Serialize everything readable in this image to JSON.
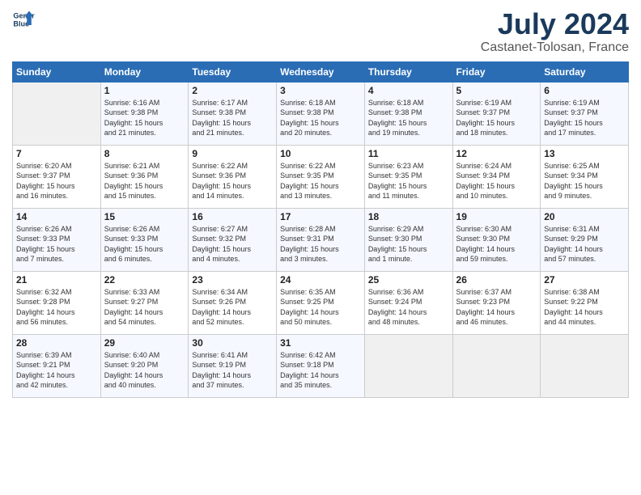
{
  "logo": {
    "line1": "General",
    "line2": "Blue"
  },
  "title": "July 2024",
  "location": "Castanet-Tolosan, France",
  "days_of_week": [
    "Sunday",
    "Monday",
    "Tuesday",
    "Wednesday",
    "Thursday",
    "Friday",
    "Saturday"
  ],
  "weeks": [
    [
      {
        "day": "",
        "info": ""
      },
      {
        "day": "1",
        "info": "Sunrise: 6:16 AM\nSunset: 9:38 PM\nDaylight: 15 hours\nand 21 minutes."
      },
      {
        "day": "2",
        "info": "Sunrise: 6:17 AM\nSunset: 9:38 PM\nDaylight: 15 hours\nand 21 minutes."
      },
      {
        "day": "3",
        "info": "Sunrise: 6:18 AM\nSunset: 9:38 PM\nDaylight: 15 hours\nand 20 minutes."
      },
      {
        "day": "4",
        "info": "Sunrise: 6:18 AM\nSunset: 9:38 PM\nDaylight: 15 hours\nand 19 minutes."
      },
      {
        "day": "5",
        "info": "Sunrise: 6:19 AM\nSunset: 9:37 PM\nDaylight: 15 hours\nand 18 minutes."
      },
      {
        "day": "6",
        "info": "Sunrise: 6:19 AM\nSunset: 9:37 PM\nDaylight: 15 hours\nand 17 minutes."
      }
    ],
    [
      {
        "day": "7",
        "info": "Sunrise: 6:20 AM\nSunset: 9:37 PM\nDaylight: 15 hours\nand 16 minutes."
      },
      {
        "day": "8",
        "info": "Sunrise: 6:21 AM\nSunset: 9:36 PM\nDaylight: 15 hours\nand 15 minutes."
      },
      {
        "day": "9",
        "info": "Sunrise: 6:22 AM\nSunset: 9:36 PM\nDaylight: 15 hours\nand 14 minutes."
      },
      {
        "day": "10",
        "info": "Sunrise: 6:22 AM\nSunset: 9:35 PM\nDaylight: 15 hours\nand 13 minutes."
      },
      {
        "day": "11",
        "info": "Sunrise: 6:23 AM\nSunset: 9:35 PM\nDaylight: 15 hours\nand 11 minutes."
      },
      {
        "day": "12",
        "info": "Sunrise: 6:24 AM\nSunset: 9:34 PM\nDaylight: 15 hours\nand 10 minutes."
      },
      {
        "day": "13",
        "info": "Sunrise: 6:25 AM\nSunset: 9:34 PM\nDaylight: 15 hours\nand 9 minutes."
      }
    ],
    [
      {
        "day": "14",
        "info": "Sunrise: 6:26 AM\nSunset: 9:33 PM\nDaylight: 15 hours\nand 7 minutes."
      },
      {
        "day": "15",
        "info": "Sunrise: 6:26 AM\nSunset: 9:33 PM\nDaylight: 15 hours\nand 6 minutes."
      },
      {
        "day": "16",
        "info": "Sunrise: 6:27 AM\nSunset: 9:32 PM\nDaylight: 15 hours\nand 4 minutes."
      },
      {
        "day": "17",
        "info": "Sunrise: 6:28 AM\nSunset: 9:31 PM\nDaylight: 15 hours\nand 3 minutes."
      },
      {
        "day": "18",
        "info": "Sunrise: 6:29 AM\nSunset: 9:30 PM\nDaylight: 15 hours\nand 1 minute."
      },
      {
        "day": "19",
        "info": "Sunrise: 6:30 AM\nSunset: 9:30 PM\nDaylight: 14 hours\nand 59 minutes."
      },
      {
        "day": "20",
        "info": "Sunrise: 6:31 AM\nSunset: 9:29 PM\nDaylight: 14 hours\nand 57 minutes."
      }
    ],
    [
      {
        "day": "21",
        "info": "Sunrise: 6:32 AM\nSunset: 9:28 PM\nDaylight: 14 hours\nand 56 minutes."
      },
      {
        "day": "22",
        "info": "Sunrise: 6:33 AM\nSunset: 9:27 PM\nDaylight: 14 hours\nand 54 minutes."
      },
      {
        "day": "23",
        "info": "Sunrise: 6:34 AM\nSunset: 9:26 PM\nDaylight: 14 hours\nand 52 minutes."
      },
      {
        "day": "24",
        "info": "Sunrise: 6:35 AM\nSunset: 9:25 PM\nDaylight: 14 hours\nand 50 minutes."
      },
      {
        "day": "25",
        "info": "Sunrise: 6:36 AM\nSunset: 9:24 PM\nDaylight: 14 hours\nand 48 minutes."
      },
      {
        "day": "26",
        "info": "Sunrise: 6:37 AM\nSunset: 9:23 PM\nDaylight: 14 hours\nand 46 minutes."
      },
      {
        "day": "27",
        "info": "Sunrise: 6:38 AM\nSunset: 9:22 PM\nDaylight: 14 hours\nand 44 minutes."
      }
    ],
    [
      {
        "day": "28",
        "info": "Sunrise: 6:39 AM\nSunset: 9:21 PM\nDaylight: 14 hours\nand 42 minutes."
      },
      {
        "day": "29",
        "info": "Sunrise: 6:40 AM\nSunset: 9:20 PM\nDaylight: 14 hours\nand 40 minutes."
      },
      {
        "day": "30",
        "info": "Sunrise: 6:41 AM\nSunset: 9:19 PM\nDaylight: 14 hours\nand 37 minutes."
      },
      {
        "day": "31",
        "info": "Sunrise: 6:42 AM\nSunset: 9:18 PM\nDaylight: 14 hours\nand 35 minutes."
      },
      {
        "day": "",
        "info": ""
      },
      {
        "day": "",
        "info": ""
      },
      {
        "day": "",
        "info": ""
      }
    ]
  ]
}
